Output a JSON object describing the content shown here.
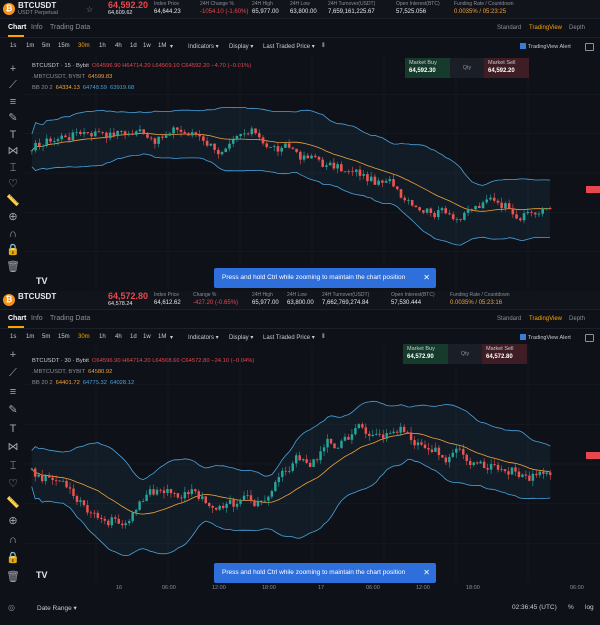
{
  "top": {
    "ticker": {
      "symbol": "BTCUSDT",
      "subtitle": "USDT Perpetual",
      "last_price": "64,592.20",
      "mark_price": "64,609.62",
      "stats": [
        {
          "label": "Index Price",
          "value": "64,644.23"
        },
        {
          "label": "24H Change %",
          "value": "-1054.10 (-1.60%)"
        },
        {
          "label": "24H High",
          "value": "65,977.00"
        },
        {
          "label": "24H Low",
          "value": "63,800.00"
        },
        {
          "label": "24H Turnover(USDT)",
          "value": "7,659,161,225.67"
        },
        {
          "label": "Open Interest(BTC)",
          "value": "57,525.056"
        },
        {
          "label": "Funding Rate / Countdown",
          "value": "0.0035% / 05:23:25"
        }
      ]
    },
    "legend": {
      "title": "BTCUSDT · 15 · Bybit",
      "ohlc": "O64596.90 H64714.20 L64569.10 C64592.20 −4.70 (−0.01%)",
      "mbtc_label": ".MBTCUSDT, BYBIT",
      "mbtc_value": "64599.83",
      "bb_label": "BB 20 2",
      "bb_basis": "64334.13",
      "bb_upper": "64748.59",
      "bb_lower": "63919.68"
    },
    "market": {
      "buy_label": "Market Buy",
      "buy_value": "64,592.30",
      "qty": "Qty",
      "sell_label": "Market Sell",
      "sell_value": "64,592.20"
    }
  },
  "bottom": {
    "ticker": {
      "symbol": "BTCUSDT",
      "last_price": "64,572.80",
      "mark_price": "64,578.24",
      "stats": [
        {
          "label": "Index Price",
          "value": "64,612.62"
        },
        {
          "label": "Change %",
          "value": "-427.20 (-0.65%)"
        },
        {
          "label": "24H High",
          "value": "65,977.00"
        },
        {
          "label": "24H Low",
          "value": "63,800.00"
        },
        {
          "label": "24H Turnover(USDT)",
          "value": "7,662,769,274.84"
        },
        {
          "label": "Open Interest(BTC)",
          "value": "57,530.444"
        },
        {
          "label": "Funding Rate / Countdown",
          "value": "0.0035% / 05:23:16"
        }
      ]
    },
    "legend": {
      "title": "BTCUSDT · 30 · Bybit",
      "ohlc": "O64596.90 H64714.20 L64568.60 C64572.80 −24.10 (−0.04%)",
      "mbtc_label": ".MBTCUSDT, BYBIT",
      "mbtc_value": "64580.92",
      "bb_label": "BB 20 2",
      "bb_basis": "64401.72",
      "bb_upper": "64775.32",
      "bb_lower": "64028.12"
    },
    "market": {
      "buy_label": "Market Buy",
      "buy_value": "64,572.90",
      "qty": "Qty",
      "sell_label": "Market Sell",
      "sell_value": "64,572.80"
    },
    "x_axis_labels": [
      "16",
      "06:00",
      "12:00",
      "18:00",
      "17",
      "06:00",
      "12:00",
      "18:00",
      "06:00"
    ],
    "date_range": "Date Range",
    "clock": "02:36:45 (UTC)",
    "percent": "%",
    "log": "log"
  },
  "tabs": {
    "chart": "Chart",
    "info": "Info",
    "trading_data": "Trading Data",
    "standard": "Standard",
    "tradingview": "TradingView",
    "depth": "Depth"
  },
  "toolbar": {
    "intervals": [
      "1s",
      "1m",
      "5m",
      "15m",
      "30m",
      "1h",
      "4h",
      "1d",
      "1w",
      "1M"
    ],
    "active_interval": "30m",
    "indicators": "Indicators",
    "display": "Display",
    "last_traded_price": "Last Traded Price",
    "tv_alert": "TradingView Alert"
  },
  "toast": "Press and hold Ctrl while zooming to maintain the chart position",
  "sidebar_icons": [
    "crosshair-icon",
    "trend-line-icon",
    "fib-icon",
    "brush-icon",
    "text-icon",
    "pattern-icon",
    "measure-icon",
    "emoji-icon",
    "ruler-icon",
    "zoom-icon",
    "magnet-icon",
    "lock-icon",
    "trash-icon"
  ],
  "colors": {
    "up": "#26a69a",
    "down": "#ef5350",
    "accent": "#f7a600",
    "bb": "#4aa3df",
    "ma": "#f2a33a"
  }
}
